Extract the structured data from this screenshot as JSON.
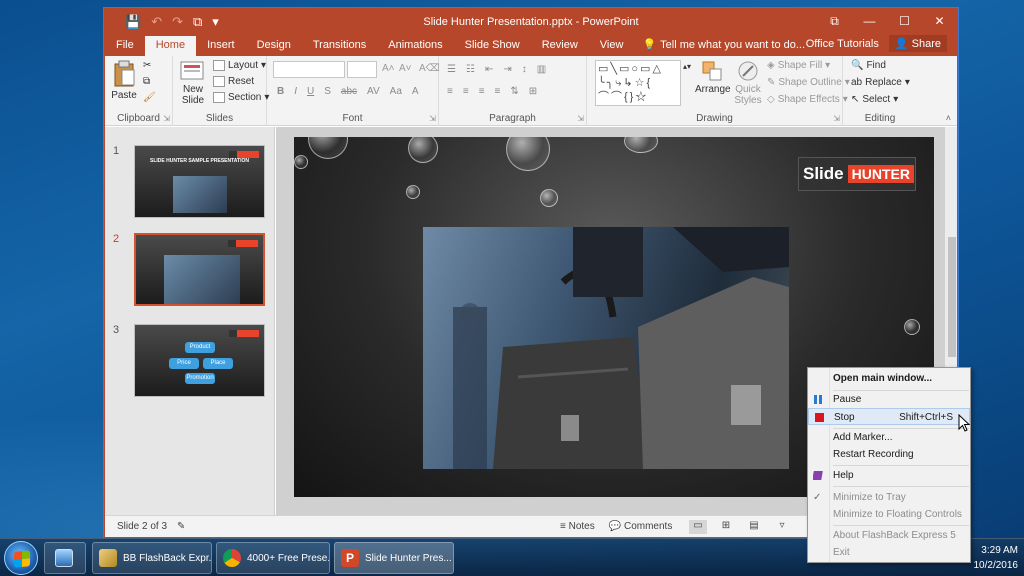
{
  "window": {
    "title": "Slide Hunter Presentation.pptx - PowerPoint",
    "controls": [
      "⧉",
      "—",
      "☐",
      "✕"
    ]
  },
  "qat": [
    "💾",
    "↶",
    "↷",
    "⧉",
    "▾"
  ],
  "tabs": [
    "File",
    "Home",
    "Insert",
    "Design",
    "Transitions",
    "Animations",
    "Slide Show",
    "Review",
    "View"
  ],
  "tellme": "Tell me what you want to do...",
  "account": {
    "user": "Office Tutorials",
    "share": "Share"
  },
  "ribbon": {
    "clipboard": {
      "label": "Clipboard",
      "paste": "Paste"
    },
    "slides": {
      "label": "Slides",
      "new_slide": "New Slide",
      "layout": "Layout",
      "reset": "Reset",
      "section": "Section"
    },
    "font": {
      "label": "Font",
      "buttons": [
        "B",
        "I",
        "U",
        "S",
        "abc",
        "AV",
        "Aa",
        "A"
      ]
    },
    "paragraph": {
      "label": "Paragraph"
    },
    "drawing": {
      "label": "Drawing",
      "arrange": "Arrange",
      "quick_styles": "Quick Styles",
      "shape_fill": "Shape Fill",
      "shape_outline": "Shape Outline",
      "shape_effects": "Shape Effects"
    },
    "editing": {
      "label": "Editing",
      "find": "Find",
      "replace": "Replace",
      "select": "Select"
    }
  },
  "thumbnails": [
    {
      "num": "1",
      "title": "SLIDE HUNTER SAMPLE PRESENTATION"
    },
    {
      "num": "2"
    },
    {
      "num": "3",
      "nodes": [
        "Product",
        "Price",
        "Place",
        "Promotion"
      ]
    }
  ],
  "slide_logo": {
    "part1": "Slide",
    "part2": "HUNTER"
  },
  "statusbar": {
    "slide_info": "Slide 2 of 3",
    "notes": "Notes",
    "comments": "Comments"
  },
  "taskbar": {
    "items": [
      "BB FlashBack Expr...",
      "4000+ Free Prese...",
      "Slide Hunter Pres..."
    ],
    "time": "3:29 AM",
    "date": "10/2/2016"
  },
  "context_menu": {
    "open_main": "Open main window...",
    "pause": "Pause",
    "stop": "Stop",
    "stop_shortcut": "Shift+Ctrl+S",
    "add_marker": "Add Marker...",
    "restart": "Restart Recording",
    "help": "Help",
    "minimize_tray": "Minimize to Tray",
    "minimize_floating": "Minimize to Floating Controls",
    "about": "About FlashBack Express 5",
    "exit": "Exit"
  },
  "colors": {
    "accent": "#b7472a",
    "selected_thumb": "#d35230",
    "logo_red": "#e8432b"
  }
}
